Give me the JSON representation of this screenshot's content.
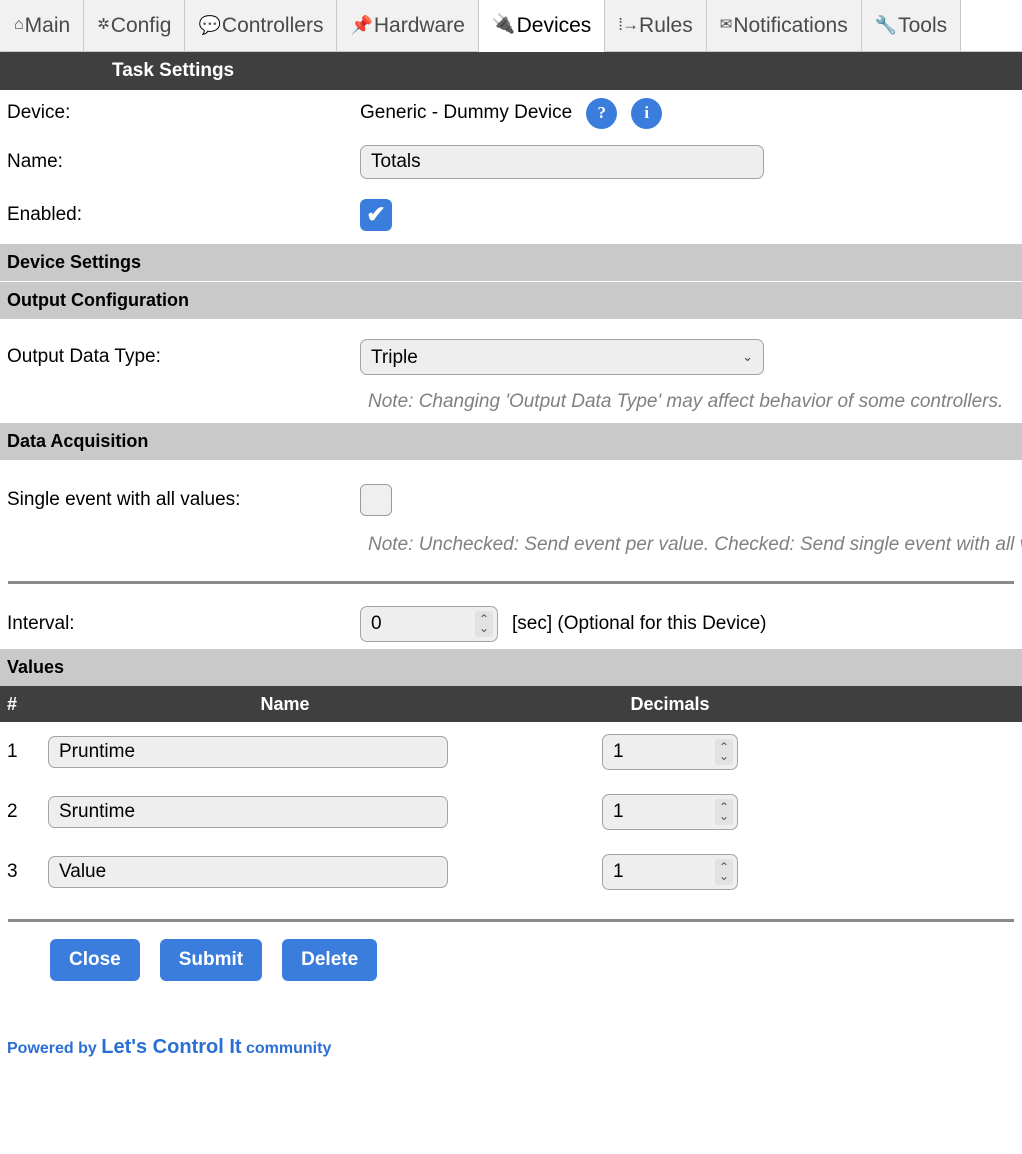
{
  "nav": {
    "tabs": [
      {
        "label": "Main",
        "icon": "house-icon",
        "glyph": "⌂",
        "cls": "house",
        "active": false
      },
      {
        "label": "Config",
        "icon": "gear-icon",
        "glyph": "✲",
        "cls": "cfg",
        "active": false
      },
      {
        "label": "Controllers",
        "icon": "speech-bubble-icon",
        "glyph": "💬",
        "cls": "bubble",
        "active": false
      },
      {
        "label": "Hardware",
        "icon": "pushpin-icon",
        "glyph": "📌",
        "cls": "pin",
        "active": false
      },
      {
        "label": "Devices",
        "icon": "plug-icon",
        "glyph": "🔌",
        "cls": "plug",
        "active": true
      },
      {
        "label": "Rules",
        "icon": "flow-arrow-icon",
        "glyph": "⁞→",
        "cls": "rules",
        "active": false
      },
      {
        "label": "Notifications",
        "icon": "envelope-icon",
        "glyph": "✉",
        "cls": "mail",
        "active": false
      },
      {
        "label": "Tools",
        "icon": "wrench-icon",
        "glyph": "🔧",
        "cls": "wrench",
        "active": false
      }
    ]
  },
  "page": {
    "title": "Task Settings"
  },
  "task": {
    "device_label": "Device:",
    "device_value": "Generic - Dummy Device",
    "help_badge": "?",
    "info_badge": "i",
    "name_label": "Name:",
    "name_value": "Totals",
    "name_placeholder": "",
    "enabled_label": "Enabled:",
    "enabled_checked": true
  },
  "sections": {
    "device_settings": "Device Settings",
    "output_configuration": "Output Configuration",
    "data_acquisition": "Data Acquisition",
    "values": "Values"
  },
  "output": {
    "data_type_label": "Output Data Type:",
    "data_type_value": "Triple",
    "data_type_options": [
      "Triple"
    ],
    "note": "Note: Changing 'Output Data Type' may affect behavior of some controllers."
  },
  "acquisition": {
    "single_event_label": "Single event with all values:",
    "single_event_checked": false,
    "note": "Note: Unchecked: Send event per value. Checked: Send single event with all values."
  },
  "interval": {
    "label": "Interval:",
    "value": "0",
    "suffix": "[sec] (Optional for this Device)"
  },
  "values_table": {
    "columns": {
      "num": "#",
      "name": "Name",
      "decimals": "Decimals"
    },
    "rows": [
      {
        "num": "1",
        "name": "Pruntime",
        "decimals": "1"
      },
      {
        "num": "2",
        "name": "Sruntime",
        "decimals": "1"
      },
      {
        "num": "3",
        "name": "Value",
        "decimals": "1"
      }
    ]
  },
  "buttons": {
    "close": "Close",
    "submit": "Submit",
    "delete": "Delete"
  },
  "footer": {
    "part1": "Powered by ",
    "part2": "Let's Control It",
    "part3": " community"
  },
  "colors": {
    "accent": "#3b7ddd",
    "dark_bar": "#3f3f3f",
    "section_bar": "#c9c9c9",
    "note_text": "#808080",
    "link": "#2b6fd4"
  }
}
